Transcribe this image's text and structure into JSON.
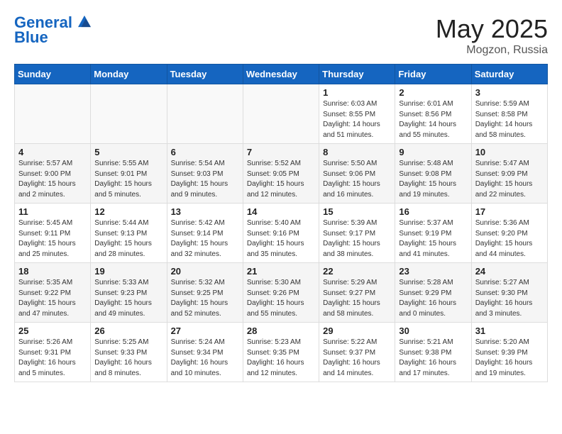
{
  "header": {
    "logo_line1": "General",
    "logo_line2": "Blue",
    "month": "May 2025",
    "location": "Mogzon, Russia"
  },
  "weekdays": [
    "Sunday",
    "Monday",
    "Tuesday",
    "Wednesday",
    "Thursday",
    "Friday",
    "Saturday"
  ],
  "weeks": [
    [
      {
        "day": "",
        "sunrise": "",
        "sunset": "",
        "daylight": ""
      },
      {
        "day": "",
        "sunrise": "",
        "sunset": "",
        "daylight": ""
      },
      {
        "day": "",
        "sunrise": "",
        "sunset": "",
        "daylight": ""
      },
      {
        "day": "",
        "sunrise": "",
        "sunset": "",
        "daylight": ""
      },
      {
        "day": "1",
        "sunrise": "Sunrise: 6:03 AM",
        "sunset": "Sunset: 8:55 PM",
        "daylight": "Daylight: 14 hours and 51 minutes."
      },
      {
        "day": "2",
        "sunrise": "Sunrise: 6:01 AM",
        "sunset": "Sunset: 8:56 PM",
        "daylight": "Daylight: 14 hours and 55 minutes."
      },
      {
        "day": "3",
        "sunrise": "Sunrise: 5:59 AM",
        "sunset": "Sunset: 8:58 PM",
        "daylight": "Daylight: 14 hours and 58 minutes."
      }
    ],
    [
      {
        "day": "4",
        "sunrise": "Sunrise: 5:57 AM",
        "sunset": "Sunset: 9:00 PM",
        "daylight": "Daylight: 15 hours and 2 minutes."
      },
      {
        "day": "5",
        "sunrise": "Sunrise: 5:55 AM",
        "sunset": "Sunset: 9:01 PM",
        "daylight": "Daylight: 15 hours and 5 minutes."
      },
      {
        "day": "6",
        "sunrise": "Sunrise: 5:54 AM",
        "sunset": "Sunset: 9:03 PM",
        "daylight": "Daylight: 15 hours and 9 minutes."
      },
      {
        "day": "7",
        "sunrise": "Sunrise: 5:52 AM",
        "sunset": "Sunset: 9:05 PM",
        "daylight": "Daylight: 15 hours and 12 minutes."
      },
      {
        "day": "8",
        "sunrise": "Sunrise: 5:50 AM",
        "sunset": "Sunset: 9:06 PM",
        "daylight": "Daylight: 15 hours and 16 minutes."
      },
      {
        "day": "9",
        "sunrise": "Sunrise: 5:48 AM",
        "sunset": "Sunset: 9:08 PM",
        "daylight": "Daylight: 15 hours and 19 minutes."
      },
      {
        "day": "10",
        "sunrise": "Sunrise: 5:47 AM",
        "sunset": "Sunset: 9:09 PM",
        "daylight": "Daylight: 15 hours and 22 minutes."
      }
    ],
    [
      {
        "day": "11",
        "sunrise": "Sunrise: 5:45 AM",
        "sunset": "Sunset: 9:11 PM",
        "daylight": "Daylight: 15 hours and 25 minutes."
      },
      {
        "day": "12",
        "sunrise": "Sunrise: 5:44 AM",
        "sunset": "Sunset: 9:13 PM",
        "daylight": "Daylight: 15 hours and 28 minutes."
      },
      {
        "day": "13",
        "sunrise": "Sunrise: 5:42 AM",
        "sunset": "Sunset: 9:14 PM",
        "daylight": "Daylight: 15 hours and 32 minutes."
      },
      {
        "day": "14",
        "sunrise": "Sunrise: 5:40 AM",
        "sunset": "Sunset: 9:16 PM",
        "daylight": "Daylight: 15 hours and 35 minutes."
      },
      {
        "day": "15",
        "sunrise": "Sunrise: 5:39 AM",
        "sunset": "Sunset: 9:17 PM",
        "daylight": "Daylight: 15 hours and 38 minutes."
      },
      {
        "day": "16",
        "sunrise": "Sunrise: 5:37 AM",
        "sunset": "Sunset: 9:19 PM",
        "daylight": "Daylight: 15 hours and 41 minutes."
      },
      {
        "day": "17",
        "sunrise": "Sunrise: 5:36 AM",
        "sunset": "Sunset: 9:20 PM",
        "daylight": "Daylight: 15 hours and 44 minutes."
      }
    ],
    [
      {
        "day": "18",
        "sunrise": "Sunrise: 5:35 AM",
        "sunset": "Sunset: 9:22 PM",
        "daylight": "Daylight: 15 hours and 47 minutes."
      },
      {
        "day": "19",
        "sunrise": "Sunrise: 5:33 AM",
        "sunset": "Sunset: 9:23 PM",
        "daylight": "Daylight: 15 hours and 49 minutes."
      },
      {
        "day": "20",
        "sunrise": "Sunrise: 5:32 AM",
        "sunset": "Sunset: 9:25 PM",
        "daylight": "Daylight: 15 hours and 52 minutes."
      },
      {
        "day": "21",
        "sunrise": "Sunrise: 5:30 AM",
        "sunset": "Sunset: 9:26 PM",
        "daylight": "Daylight: 15 hours and 55 minutes."
      },
      {
        "day": "22",
        "sunrise": "Sunrise: 5:29 AM",
        "sunset": "Sunset: 9:27 PM",
        "daylight": "Daylight: 15 hours and 58 minutes."
      },
      {
        "day": "23",
        "sunrise": "Sunrise: 5:28 AM",
        "sunset": "Sunset: 9:29 PM",
        "daylight": "Daylight: 16 hours and 0 minutes."
      },
      {
        "day": "24",
        "sunrise": "Sunrise: 5:27 AM",
        "sunset": "Sunset: 9:30 PM",
        "daylight": "Daylight: 16 hours and 3 minutes."
      }
    ],
    [
      {
        "day": "25",
        "sunrise": "Sunrise: 5:26 AM",
        "sunset": "Sunset: 9:31 PM",
        "daylight": "Daylight: 16 hours and 5 minutes."
      },
      {
        "day": "26",
        "sunrise": "Sunrise: 5:25 AM",
        "sunset": "Sunset: 9:33 PM",
        "daylight": "Daylight: 16 hours and 8 minutes."
      },
      {
        "day": "27",
        "sunrise": "Sunrise: 5:24 AM",
        "sunset": "Sunset: 9:34 PM",
        "daylight": "Daylight: 16 hours and 10 minutes."
      },
      {
        "day": "28",
        "sunrise": "Sunrise: 5:23 AM",
        "sunset": "Sunset: 9:35 PM",
        "daylight": "Daylight: 16 hours and 12 minutes."
      },
      {
        "day": "29",
        "sunrise": "Sunrise: 5:22 AM",
        "sunset": "Sunset: 9:37 PM",
        "daylight": "Daylight: 16 hours and 14 minutes."
      },
      {
        "day": "30",
        "sunrise": "Sunrise: 5:21 AM",
        "sunset": "Sunset: 9:38 PM",
        "daylight": "Daylight: 16 hours and 17 minutes."
      },
      {
        "day": "31",
        "sunrise": "Sunrise: 5:20 AM",
        "sunset": "Sunset: 9:39 PM",
        "daylight": "Daylight: 16 hours and 19 minutes."
      }
    ]
  ]
}
